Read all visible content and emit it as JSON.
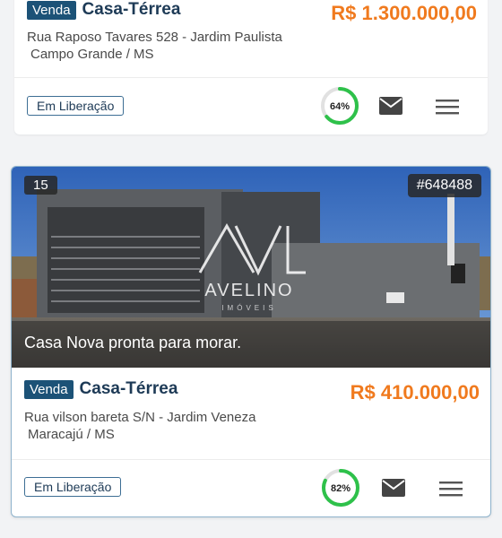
{
  "listings": [
    {
      "offer": "Venda",
      "type": "Casa-Térrea",
      "price": "R$ 1.300.000,00",
      "address_line1": "Rua Raposo Tavares 528 - Jardim Paulista",
      "address_line2": "Campo Grande /  MS",
      "status": "Em Liberação",
      "progress_label": "64%",
      "progress_value": 0.64
    },
    {
      "photo_count": "15",
      "code": "#648488",
      "caption": "Casa Nova pronta para morar.",
      "watermark_name": "AVELINO",
      "watermark_sub": "IMÓVEIS",
      "offer": "Venda",
      "type": "Casa-Térrea",
      "price": "R$ 410.000,00",
      "address_line1": "Rua vilson bareta S/N - Jardim Veneza",
      "address_line2": "Maracajú /  MS",
      "status": "Em Liberação",
      "progress_label": "82%",
      "progress_value": 0.82
    }
  ],
  "colors": {
    "offer_badge": "#1c5277",
    "price": "#f07a1e",
    "progress": "#2ec14a"
  },
  "icons": {
    "mail": "mail-icon",
    "menu": "menu-icon"
  }
}
